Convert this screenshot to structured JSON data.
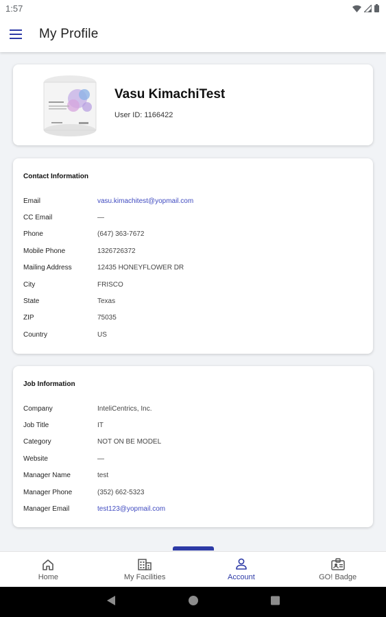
{
  "status_bar": {
    "time": "1:57"
  },
  "app_bar": {
    "title": "My Profile"
  },
  "profile": {
    "name": "Vasu KimachiTest",
    "user_id": "User ID: 1166422"
  },
  "contact": {
    "title": "Contact Information",
    "rows": [
      {
        "label": "Email",
        "value": "vasu.kimachitest@yopmail.com"
      },
      {
        "label": "CC Email",
        "value": "—"
      },
      {
        "label": "Phone",
        "value": "(647) 363-7672"
      },
      {
        "label": "Mobile Phone",
        "value": "1326726372"
      },
      {
        "label": "Mailing Address",
        "value": "12435 HONEYFLOWER DR"
      },
      {
        "label": "City",
        "value": "FRISCO"
      },
      {
        "label": "State",
        "value": "Texas"
      },
      {
        "label": "ZIP",
        "value": "75035"
      },
      {
        "label": "Country",
        "value": "US"
      }
    ]
  },
  "job": {
    "title": "Job Information",
    "rows": [
      {
        "label": "Company",
        "value": "InteliCentrics, Inc."
      },
      {
        "label": "Job Title",
        "value": "IT"
      },
      {
        "label": "Category",
        "value": "NOT ON BE MODEL"
      },
      {
        "label": "Website",
        "value": "—"
      },
      {
        "label": "Manager Name",
        "value": "test"
      },
      {
        "label": "Manager Phone",
        "value": "(352) 662-5323"
      },
      {
        "label": "Manager Email",
        "value": "test123@yopmail.com"
      }
    ]
  },
  "bottom_nav": {
    "items": [
      {
        "label": "Home",
        "icon": "home-icon"
      },
      {
        "label": "My Facilities",
        "icon": "building-icon"
      },
      {
        "label": "Account",
        "icon": "account-icon"
      },
      {
        "label": "GO! Badge",
        "icon": "badge-icon"
      }
    ],
    "active": "Account"
  },
  "colors": {
    "accent": "#2d3aa6",
    "link": "#3f4ac0",
    "background": "#f1f3f6"
  }
}
